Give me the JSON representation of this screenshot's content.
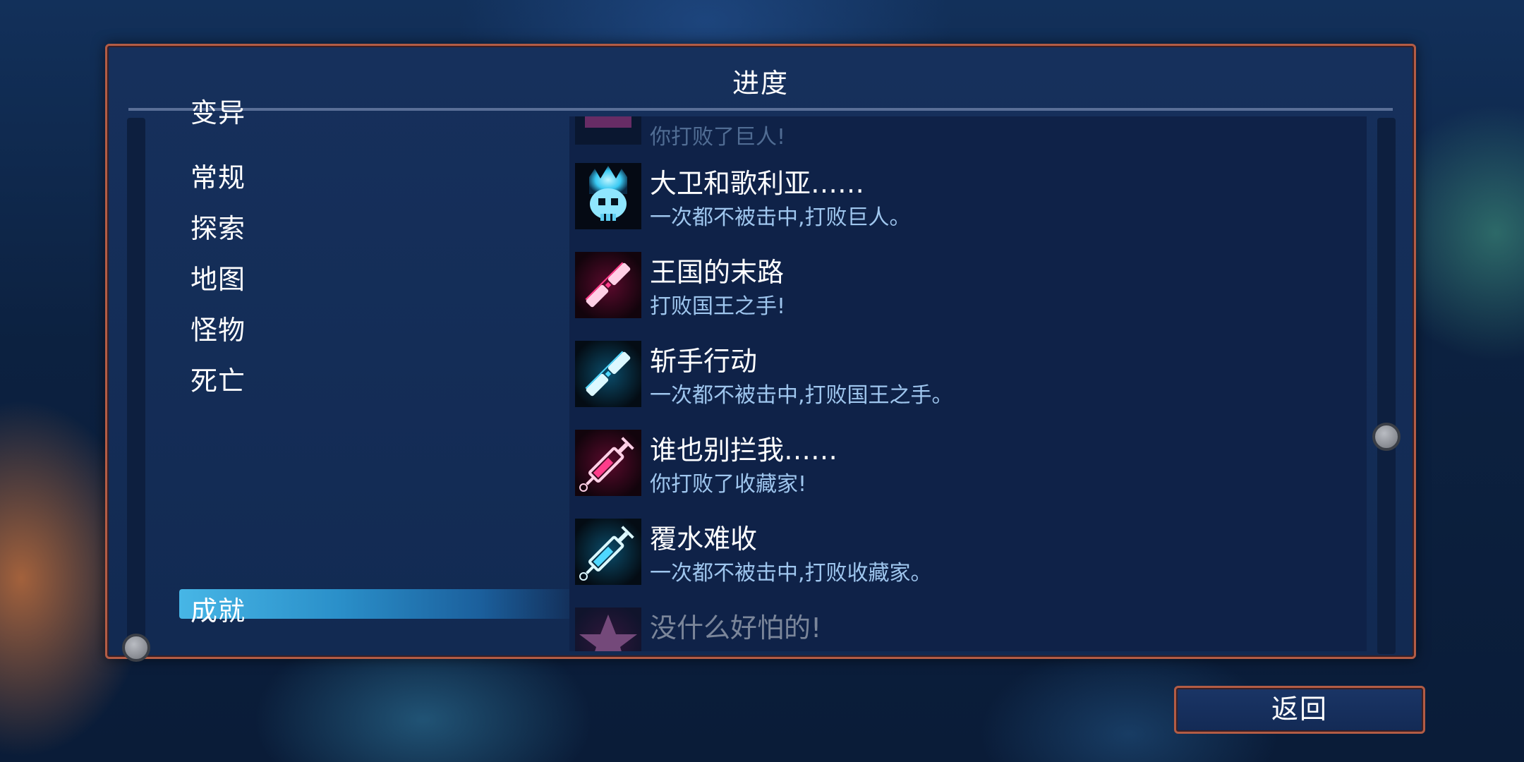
{
  "screen": {
    "title": "进度"
  },
  "categories": {
    "items": [
      {
        "label": "变异"
      },
      {
        "label": "常规"
      },
      {
        "label": "探索"
      },
      {
        "label": "地图"
      },
      {
        "label": "怪物"
      },
      {
        "label": "死亡"
      },
      {
        "label": "成就",
        "selected": true
      }
    ]
  },
  "achievements": [
    {
      "title": "",
      "desc": "你打败了巨人!",
      "icon": "boss-icon",
      "accent": "#d23a8a",
      "partial": true
    },
    {
      "title": "大卫和歌利亚……",
      "desc": "一次都不被击中,打败巨人。",
      "icon": "skull-crown-icon",
      "accent": "#4fd8ff"
    },
    {
      "title": "王国的末路",
      "desc": "打败国王之手!",
      "icon": "sword-icon",
      "accent": "#ff3d8b"
    },
    {
      "title": "斩手行动",
      "desc": "一次都不被击中,打败国王之手。",
      "icon": "sword-icon",
      "accent": "#4fd8ff"
    },
    {
      "title": "谁也别拦我……",
      "desc": "你打败了收藏家!",
      "icon": "syringe-icon",
      "accent": "#ff3d8b"
    },
    {
      "title": "覆水难收",
      "desc": "一次都不被击中,打败收藏家。",
      "icon": "syringe-icon",
      "accent": "#4fd8ff"
    },
    {
      "title": "没什么好怕的!",
      "desc": "",
      "icon": "star-icon",
      "accent": "#d23a8a",
      "partial": true
    }
  ],
  "buttons": {
    "back_label": "返回"
  },
  "scroll": {
    "left_position": 1.0,
    "right_position": 0.5
  },
  "colors": {
    "frame": "#b35c45",
    "panel": "#16305c",
    "selected": "#47b6e6",
    "desc_text": "#9fc6ee"
  }
}
